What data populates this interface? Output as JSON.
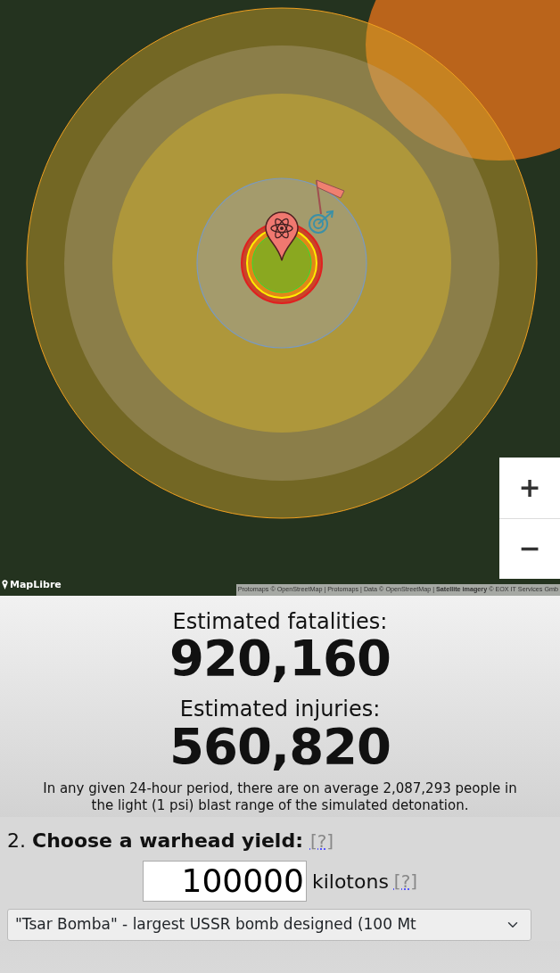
{
  "map": {
    "logo": "MapLibre",
    "zoom_in": "+",
    "zoom_out": "−",
    "attribution": [
      {
        "text": "Protomaps © OpenStreetMap | Protomaps | Data © OpenStreetMap |",
        "bold": false
      },
      {
        "text": "Satellite imagery",
        "bold": true
      },
      {
        "text": "© EOX IT Services Gmb",
        "bold": false
      }
    ]
  },
  "results": [
    {
      "label": "Estimated fatalities:",
      "value": "920,160"
    },
    {
      "label": "Estimated injuries:",
      "value": "560,820"
    }
  ],
  "note": "In any given 24-hour period, there are on average 2,087,293 people in the light (1 psi) blast range of the simulated detonation.",
  "yield": {
    "heading": "2. **Choose a warhead yield:**",
    "help": "[?]",
    "value": "100000",
    "unit": "kilotons",
    "unit_help": "[?]",
    "preset": "\"Tsar Bomba\" - largest USSR bomb designed (100 Mt"
  }
}
